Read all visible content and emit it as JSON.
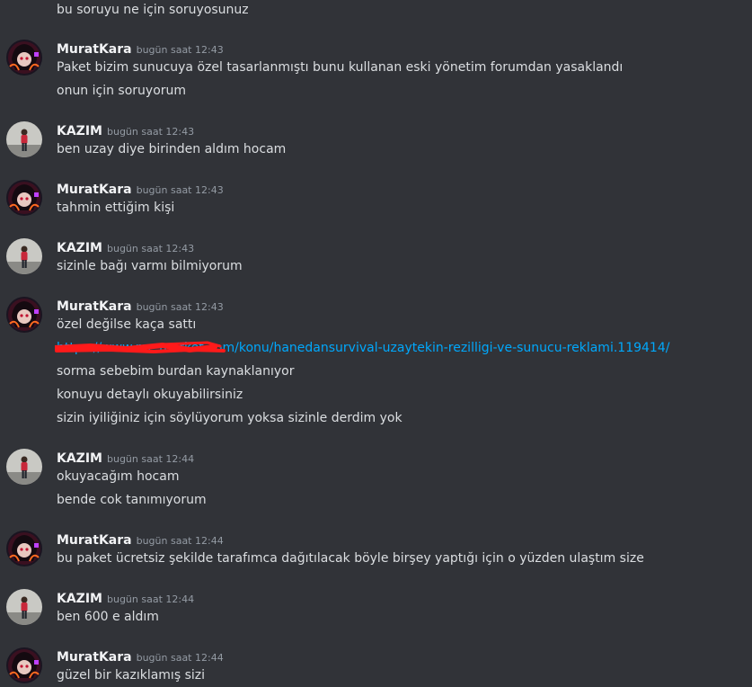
{
  "messages": {
    "top_text": "bu soruyu ne için soruyosunuz",
    "groups": [
      {
        "user": "MuratKara",
        "time": "bugün saat 12:43",
        "lines": [
          "Paket bizim sunucuya özel tasarlanmıştı bunu kullanan eski yönetim forumdan yasaklandı",
          "onun için soruyorum"
        ]
      },
      {
        "user": "KAZIM",
        "time": "bugün saat 12:43",
        "lines": [
          "ben uzay diye birinden aldım hocam"
        ]
      },
      {
        "user": "MuratKara",
        "time": "bugün saat 12:43",
        "lines": [
          "tahmin ettiğim kişi"
        ]
      },
      {
        "user": "KAZIM",
        "time": "bugün saat 12:43",
        "lines": [
          "sizinle bağı varmı bilmiyorum"
        ]
      },
      {
        "user": "MuratKara",
        "time": "bugün saat 12:43",
        "lines": [
          "özel değilse kaça sattı",
          "https://www.mc-market.com/konu/hanedansurvival-uzaytekin-rezilligi-ve-sunucu-reklami.119414/",
          "sorma sebebim burdan kaynaklanıyor",
          "konuyu detaylı okuyabilirsiniz",
          "sizin iyiliğiniz için söylüyorum yoksa sizinle derdim yok"
        ]
      },
      {
        "user": "KAZIM",
        "time": "bugün saat 12:44",
        "lines": [
          "okuyacağım hocam",
          "bende cok tanımıyorum"
        ]
      },
      {
        "user": "MuratKara",
        "time": "bugün saat 12:44",
        "lines": [
          "bu paket ücretsiz şekilde tarafımca dağıtılacak böyle birşey yaptığı için o yüzden ulaştım size"
        ]
      },
      {
        "user": "KAZIM",
        "time": "bugün saat 12:44",
        "lines": [
          "ben 600 e aldım"
        ]
      },
      {
        "user": "MuratKara",
        "time": "bugün saat 12:44",
        "lines": [
          "güzel bir kazıklamış sizi"
        ]
      }
    ]
  },
  "colors": {
    "background": "#313338",
    "text": "#dbdee1",
    "username": "#f2f3f5",
    "timestamp": "#949ba4",
    "link": "#00a8fc",
    "redaction": "#ff1a1a"
  },
  "icons": {
    "muratkara": "anime-avatar",
    "kazim": "person-photo-avatar"
  }
}
